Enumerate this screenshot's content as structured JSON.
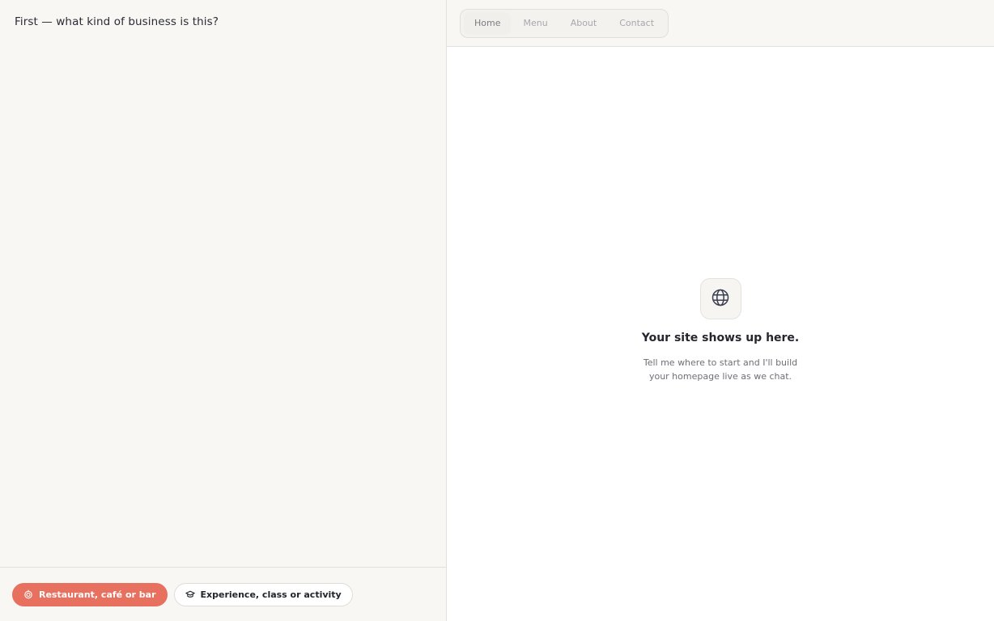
{
  "chat": {
    "prompt": "First — what kind of business is this?",
    "options": [
      {
        "label": "Restaurant, café or bar",
        "icon": "restaurant-icon",
        "style": "primary"
      },
      {
        "label": "Experience, class or activity",
        "icon": "graduation-cap-icon",
        "style": "secondary"
      }
    ]
  },
  "preview": {
    "tabs": [
      {
        "label": "Home",
        "active": true
      },
      {
        "label": "Menu",
        "active": false
      },
      {
        "label": "About",
        "active": false
      },
      {
        "label": "Contact",
        "active": false
      }
    ],
    "empty_icon": "globe-icon",
    "title": "Your site shows up here.",
    "subtitle": "Tell me where to start and I'll build your homepage live as we chat."
  },
  "colors": {
    "accent": "#e8705f",
    "panel_bg": "#f8f7f4",
    "preview_bg": "#ffffff",
    "text": "#2a2a33",
    "muted": "#a9a7ad"
  }
}
